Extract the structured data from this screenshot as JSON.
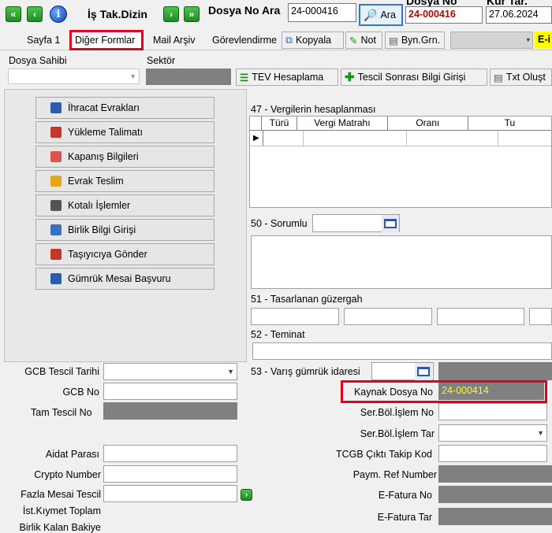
{
  "toolbar": {
    "first_icon": "double-left-arrow-icon",
    "prev_icon": "left-arrow-icon",
    "info_icon": "info-icon",
    "info_glyph": "i",
    "title": "İş Tak.Dizin",
    "next_icon": "right-arrow-icon",
    "last_icon": "double-right-arrow-icon",
    "dosya_no_ara_label": "Dosya No Ara",
    "dosya_no_ara_value": "24-000416",
    "ara_button": "Ara",
    "dosya_no_label": "Dosya No",
    "dosya_no_value": "24-000416",
    "kur_tar_label": "Kur Tar.",
    "kur_tar_value": "27.06.2024"
  },
  "tabs": [
    {
      "label": "Sayfa 1"
    },
    {
      "label": "Diğer Formlar"
    },
    {
      "label": "Mail Arşiv"
    },
    {
      "label": "Görevlendirme"
    }
  ],
  "tab_buttons": {
    "kopyala": "Kopyala",
    "not": "Not",
    "byn_grn": "Byn.Grn.",
    "e_label": "E-i"
  },
  "top_form": {
    "dosya_sahibi_label": "Dosya Sahibi",
    "sektor_label": "Sektör",
    "tev_button": "TEV Hesaplama",
    "tescil_button": "Tescil Sonrası Bilgi Girişi",
    "txt_button": "Txt Oluşt"
  },
  "forms_menu": [
    {
      "label": "İhracat Evrakları",
      "icon": "document-list-icon",
      "color": "#2a5db0"
    },
    {
      "label": "Yükleme Talimatı",
      "icon": "truck-icon",
      "color": "#c0392b"
    },
    {
      "label": "Kapanış Bilgileri",
      "icon": "close-document-icon",
      "color": "#d9534f"
    },
    {
      "label": "Evrak Teslim",
      "icon": "folder-icon",
      "color": "#e6a817"
    },
    {
      "label": "Kotalı İşlemler",
      "icon": "calendar-icon",
      "color": "#555555"
    },
    {
      "label": "Birlik Bilgi Girişi",
      "icon": "people-icon",
      "color": "#3a6fc4"
    },
    {
      "label": "Taşıyıcıya Gönder",
      "icon": "truck-icon",
      "color": "#c0392b"
    },
    {
      "label": "Gümrük Mesai Başvuru",
      "icon": "pencil-note-icon",
      "color": "#2a5db0"
    }
  ],
  "right_panel": {
    "vergi_label": "47 - Vergilerin hesaplanması",
    "grid_headers": [
      "Türü",
      "Vergi Matrahı",
      "Oranı",
      "Tu"
    ],
    "sorumlu_label": "50 - Sorumlu",
    "guzergah_label": "51 - Tasarlanan güzergah",
    "teminat_label": "52 - Teminat",
    "varis_label": "53 - Varış gümrük idaresi"
  },
  "left_fields": {
    "gcb_tescil_tarihi": "GCB Tescil Tarihi",
    "gcb_no": "GCB No",
    "tam_tescil_no": "Tam Tescil No",
    "aidat_parasi": "Aidat Parası",
    "crypto_number": "Crypto Number",
    "fazla_mesai_tescil": "Fazla Mesai Tescil",
    "ist_kiymet_toplam": "İst.Kıymet Toplam",
    "birlik_kalan_bakiye": "Birlik Kalan Bakiye"
  },
  "right_fields": {
    "kaynak_dosya_no_label": "Kaynak Dosya No",
    "kaynak_dosya_no_value": "24-000414",
    "ser_bol_islem_no": "Ser.Böl.İşlem No",
    "ser_bol_islem_tar": "Ser.Böl.İşlem Tar",
    "tcgb_cikti_takip_kod": "TCGB Çıktı Takip Kod",
    "paym_ref_number": "Paym. Ref Number",
    "e_fatura_no": "E-Fatura No",
    "e_fatura_tar": "E-Fatura Tar"
  },
  "colors": {
    "highlight_red": "#e4001b",
    "kaynak_text": "#ffff00",
    "dosya_no_text": "#c00000"
  }
}
